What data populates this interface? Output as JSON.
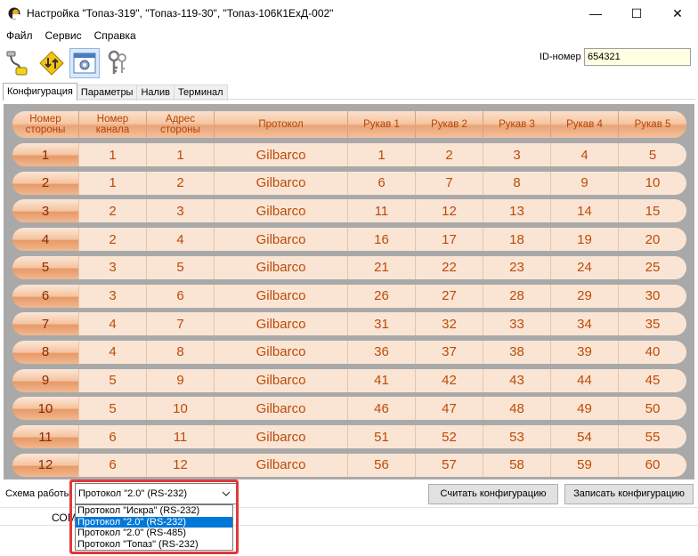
{
  "window": {
    "title": "Настройка \"Топаз-319\", \"Топаз-119-30\", \"Топаз-106К1ЕхД-002\"",
    "minimize": "—",
    "maximize": "☐",
    "close": "✕"
  },
  "menu": [
    "Файл",
    "Сервис",
    "Справка"
  ],
  "toolbar": {
    "icons": [
      "connection-icon",
      "exchange-icon",
      "settings-icon",
      "keys-icon"
    ],
    "active_index": 2
  },
  "id_field": {
    "label": "ID-номер",
    "value": "654321"
  },
  "tabs": [
    {
      "label": "Конфигурация",
      "active": true
    },
    {
      "label": "Параметры",
      "active": false
    },
    {
      "label": "Налив",
      "active": false
    },
    {
      "label": "Терминал",
      "active": false
    }
  ],
  "table": {
    "headers": [
      "Номер стороны",
      "Номер канала",
      "Адрес стороны",
      "Протокол",
      "Рукав 1",
      "Рукав 2",
      "Рукав 3",
      "Рукав 4",
      "Рукав 5"
    ],
    "rows": [
      [
        "1",
        "1",
        "1",
        "Gilbarco",
        "1",
        "2",
        "3",
        "4",
        "5"
      ],
      [
        "2",
        "1",
        "2",
        "Gilbarco",
        "6",
        "7",
        "8",
        "9",
        "10"
      ],
      [
        "3",
        "2",
        "3",
        "Gilbarco",
        "11",
        "12",
        "13",
        "14",
        "15"
      ],
      [
        "4",
        "2",
        "4",
        "Gilbarco",
        "16",
        "17",
        "18",
        "19",
        "20"
      ],
      [
        "5",
        "3",
        "5",
        "Gilbarco",
        "21",
        "22",
        "23",
        "24",
        "25"
      ],
      [
        "6",
        "3",
        "6",
        "Gilbarco",
        "26",
        "27",
        "28",
        "29",
        "30"
      ],
      [
        "7",
        "4",
        "7",
        "Gilbarco",
        "31",
        "32",
        "33",
        "34",
        "35"
      ],
      [
        "8",
        "4",
        "8",
        "Gilbarco",
        "36",
        "37",
        "38",
        "39",
        "40"
      ],
      [
        "9",
        "5",
        "9",
        "Gilbarco",
        "41",
        "42",
        "43",
        "44",
        "45"
      ],
      [
        "10",
        "5",
        "10",
        "Gilbarco",
        "46",
        "47",
        "48",
        "49",
        "50"
      ],
      [
        "11",
        "6",
        "11",
        "Gilbarco",
        "51",
        "52",
        "53",
        "54",
        "55"
      ],
      [
        "12",
        "6",
        "12",
        "Gilbarco",
        "56",
        "57",
        "58",
        "59",
        "60"
      ]
    ]
  },
  "bottom": {
    "scheme_label": "Схема работы",
    "scheme_value": "Протокол \"2.0\" (RS-232)",
    "options": [
      "Протокол \"Искра\" (RS-232)",
      "Протокол \"2.0\" (RS-232)",
      "Протокол \"2.0\" (RS-485)",
      "Протокол \"Топаз\" (RS-232)"
    ],
    "selected_index": 1,
    "read_button": "Считать конфигурацию",
    "write_button": "Записать конфигурацию",
    "status": "СОМ"
  },
  "colors": {
    "highlight": "#e03a3a",
    "selection": "#0078d7",
    "cell_text": "#bd4a08"
  }
}
